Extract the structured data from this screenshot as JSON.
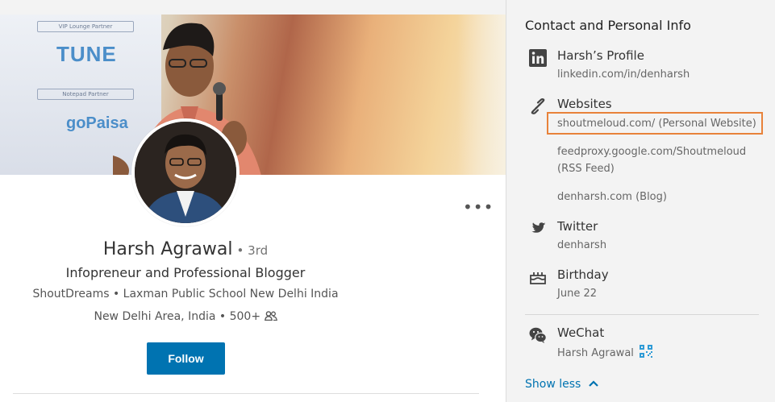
{
  "profile": {
    "name": "Harsh Agrawal",
    "degree": "• 3rd",
    "headline": "Infopreneur and Professional Blogger",
    "company_school": "ShoutDreams • Laxman Public School New Delhi India",
    "location": "New Delhi Area, India",
    "connections": "• 500+",
    "follow_label": "Follow",
    "more_label": "•••",
    "banner_signs": [
      "VIP Lounge Partner",
      "Notepad Partner"
    ],
    "banner_logo_top": "TUNE",
    "banner_logo_bottom": "goPaisa"
  },
  "contact": {
    "title": "Contact and Personal Info",
    "profile": {
      "title": "Harsh’s Profile",
      "value": "linkedin.com/in/denharsh"
    },
    "websites": {
      "title": "Websites",
      "items": [
        "shoutmeloud.com/ (Personal Website)",
        "feedproxy.google.com/Shoutmeloud (RSS Feed)",
        "denharsh.com (Blog)"
      ]
    },
    "twitter": {
      "title": "Twitter",
      "value": "denharsh"
    },
    "birthday": {
      "title": "Birthday",
      "value": "June 22"
    },
    "wechat": {
      "title": "WeChat",
      "value": "Harsh Agrawal"
    },
    "show_less": "Show less"
  },
  "colors": {
    "linkedin_blue": "#0073b1",
    "highlight_orange": "#e8823a",
    "qr_blue": "#2f9bd6"
  }
}
